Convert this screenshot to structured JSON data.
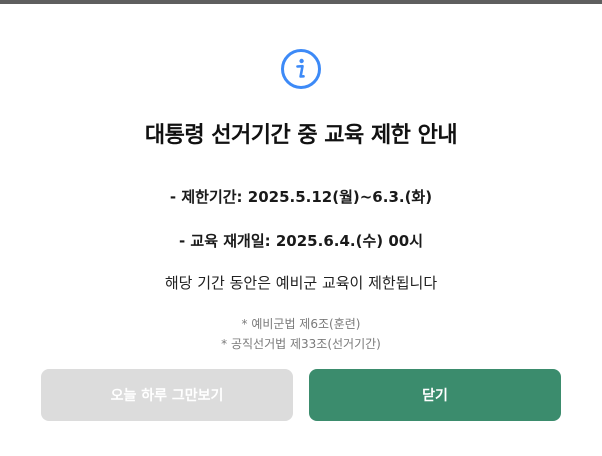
{
  "modal": {
    "icon": "info-icon",
    "title": "대통령 선거기간 중 교육 제한 안내",
    "period_line": "- 제한기간: 2025.5.12(월)~6.3.(화)",
    "resume_line": "- 교육 재개일: 2025.6.4.(수) 00시",
    "notice": "해당 기간 동안은 예비군 교육이 제한됩니다",
    "references": [
      "* 예비군법 제6조(훈련)",
      "* 공직선거법 제33조(선거기간)"
    ],
    "buttons": {
      "hide_today": "오늘 하루 그만보기",
      "close": "닫기"
    }
  },
  "colors": {
    "accent_icon": "#3d8af7",
    "close_button": "#3b8c6d",
    "hide_button": "#dcdcdc"
  }
}
